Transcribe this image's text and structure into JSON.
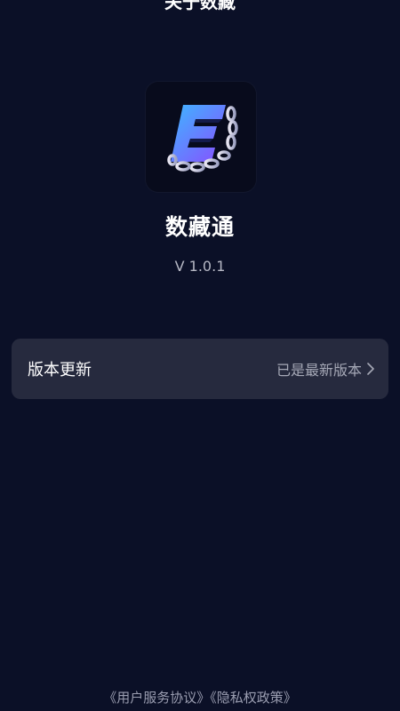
{
  "header": {
    "title": "关于数藏"
  },
  "app": {
    "name": "数藏通",
    "version": "V 1.0.1",
    "logo_icon": "chain-letter-e-logo"
  },
  "update_row": {
    "label": "版本更新",
    "status": "已是最新版本",
    "chevron_icon": "chevron-right-icon"
  },
  "footer": {
    "user_agreement": "《用户服务协议》",
    "privacy_policy": "《隐私权政策》"
  },
  "colors": {
    "background": "#0b1027",
    "card": "#262a3e",
    "logo_gradient_start": "#3db7ff",
    "logo_gradient_end": "#8a4dff"
  }
}
